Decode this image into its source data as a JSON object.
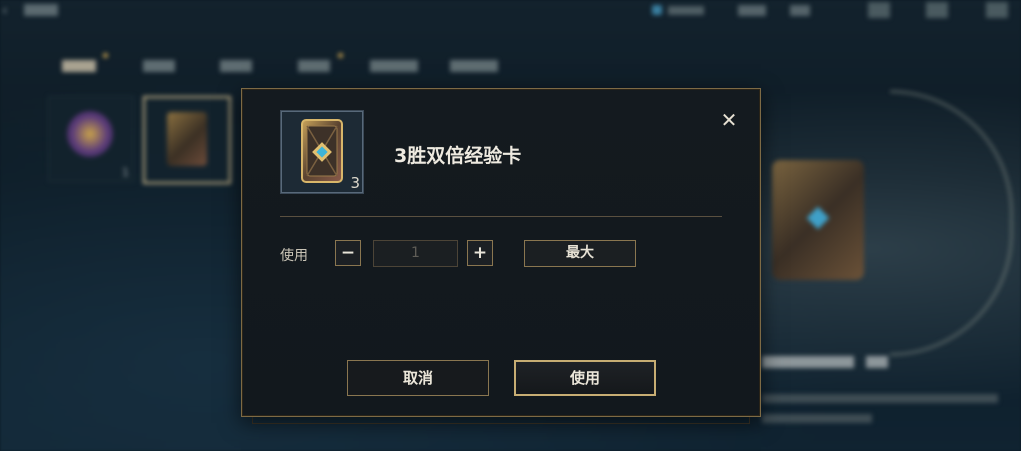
{
  "dialog": {
    "item": {
      "name": "3胜双倍经验卡",
      "count": "3",
      "icon": "double-exp-card-icon"
    },
    "close_icon": "close-icon",
    "quantity": {
      "label": "使用",
      "minus": "−",
      "plus": "+",
      "value": "1",
      "max_label": "最大"
    },
    "buttons": {
      "cancel": "取消",
      "confirm": "使用"
    }
  },
  "background": {
    "slots": [
      {
        "count": "1"
      }
    ]
  },
  "colors": {
    "gold_border": "#8a7650",
    "gold_accent": "#c7ad73",
    "dialog_bg": "#141a1f"
  }
}
